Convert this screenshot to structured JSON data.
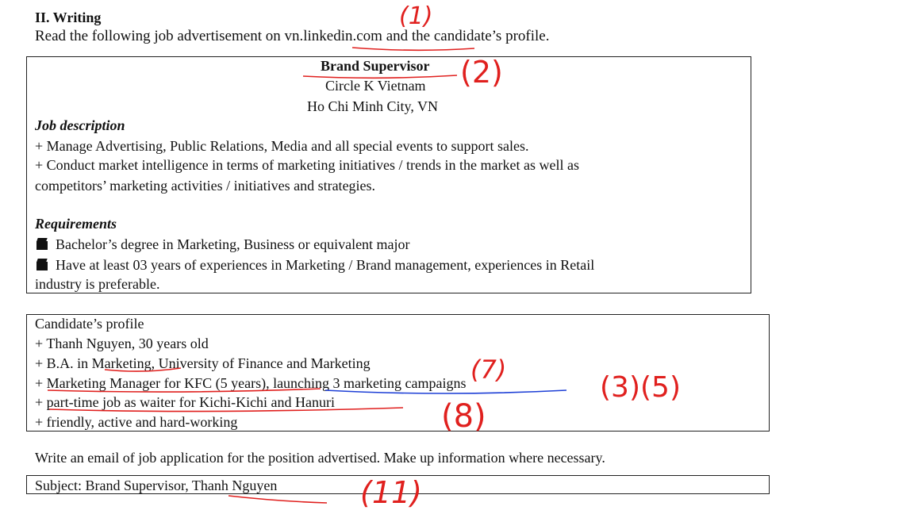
{
  "section": {
    "heading": "II. Writing",
    "instruction_prefix": "Read the following job advertisement on ",
    "site": "vn.linkedin.com",
    "instruction_suffix": " and the candidate’s profile."
  },
  "job_ad": {
    "title": "Brand Supervisor",
    "company": "Circle K Vietnam",
    "location": "Ho Chi Minh City, VN",
    "description_heading": "Job description",
    "description_lines": [
      "+ Manage Advertising, Public Relations, Media and all special events to support sales.",
      "+ Conduct market intelligence in terms of marketing initiatives / trends in the market as well as",
      "competitors’ marketing activities / initiatives and strategies."
    ],
    "requirements_heading": "Requirements",
    "requirement_1": "Bachelor’s degree in Marketing, Business or equivalent major",
    "requirement_2_line1": "Have at least 03 years of experiences in Marketing / Brand management, experiences in Retail",
    "requirement_2_line2": "industry is preferable."
  },
  "profile": {
    "heading": "Candidate’s profile",
    "lines": [
      "+ Thanh Nguyen, 30 years old",
      "+ B.A. in Marketing, University of Finance and Marketing",
      "+ Marketing Manager for KFC (5 years), launching 3 marketing campaigns",
      "+ part-time job as waiter for Kichi-Kichi and Hanuri",
      "+ friendly, active and hard-working"
    ]
  },
  "task": "Write an email of job application for the position advertised. Make up information where necessary.",
  "subject": "Subject: Brand Supervisor, Thanh Nguyen",
  "annotations": [
    "(1)",
    "(2)",
    "(7)",
    "(3)(5)",
    "(8)",
    "(11)"
  ],
  "colors": {
    "red_ink": "#e0201e",
    "blue_ink": "#1d3fd6"
  }
}
